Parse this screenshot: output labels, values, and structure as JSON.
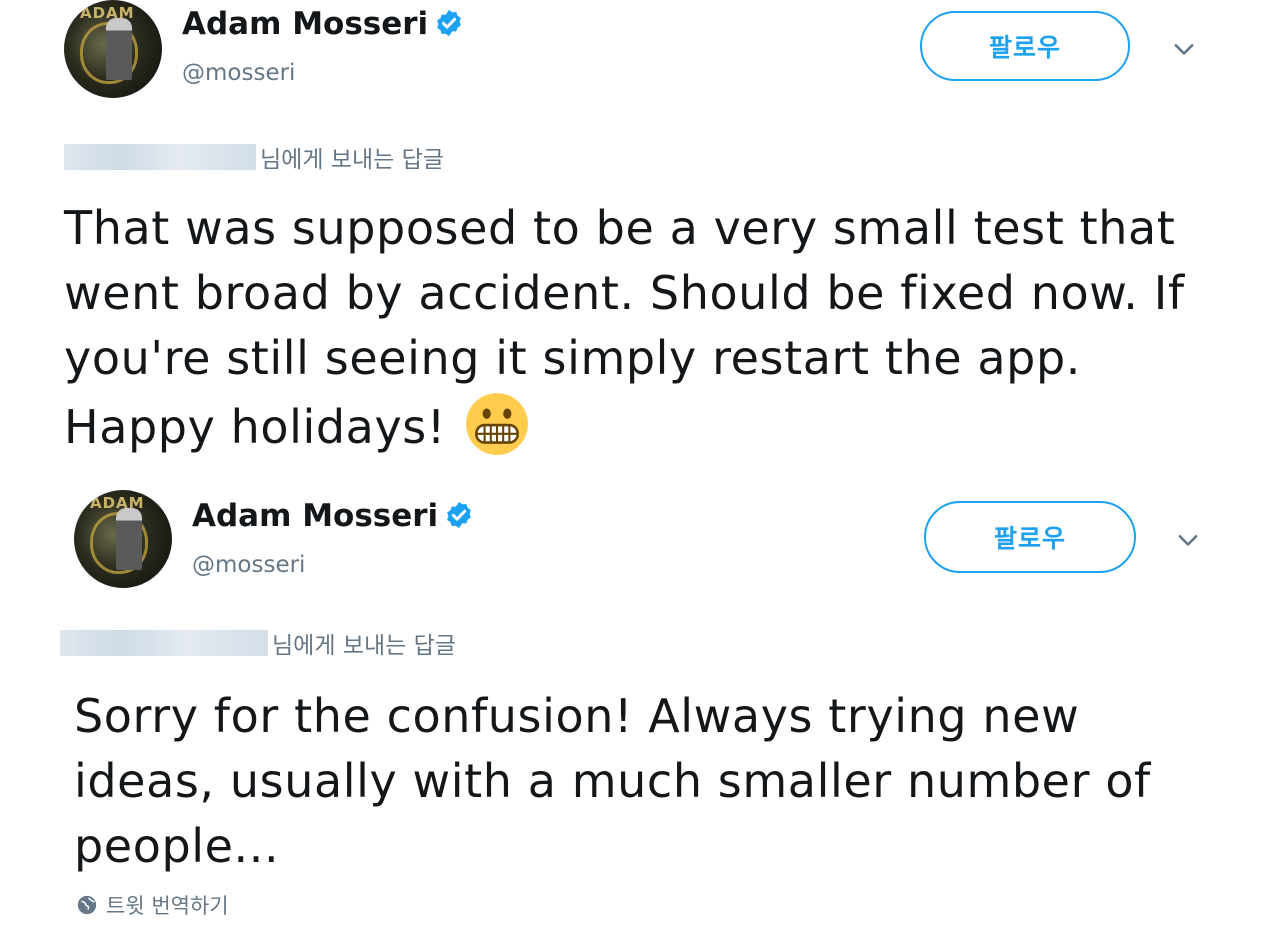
{
  "tweets": [
    {
      "author": {
        "name": "Adam Mosseri",
        "handle": "@mosseri",
        "avatar_text": "ADAM"
      },
      "follow_label": "팔로우",
      "reply_to_suffix": "님에게 보내는 답글",
      "text": "That was supposed to be a very small test that went broad by accident. Should be fixed now. If you're still seeing it simply restart the app. Happy holidays!",
      "emoji": "grimacing-face"
    },
    {
      "author": {
        "name": "Adam Mosseri",
        "handle": "@mosseri",
        "avatar_text": "ADAM"
      },
      "follow_label": "팔로우",
      "reply_to_suffix": "님에게 보내는 답글",
      "text": "Sorry for the confusion! Always trying new ideas, usually with a much smaller number of people...",
      "translate_label": "트윗 번역하기"
    }
  ],
  "colors": {
    "accent": "#1da1f2",
    "secondary_text": "#657786",
    "primary_text": "#14171a"
  }
}
